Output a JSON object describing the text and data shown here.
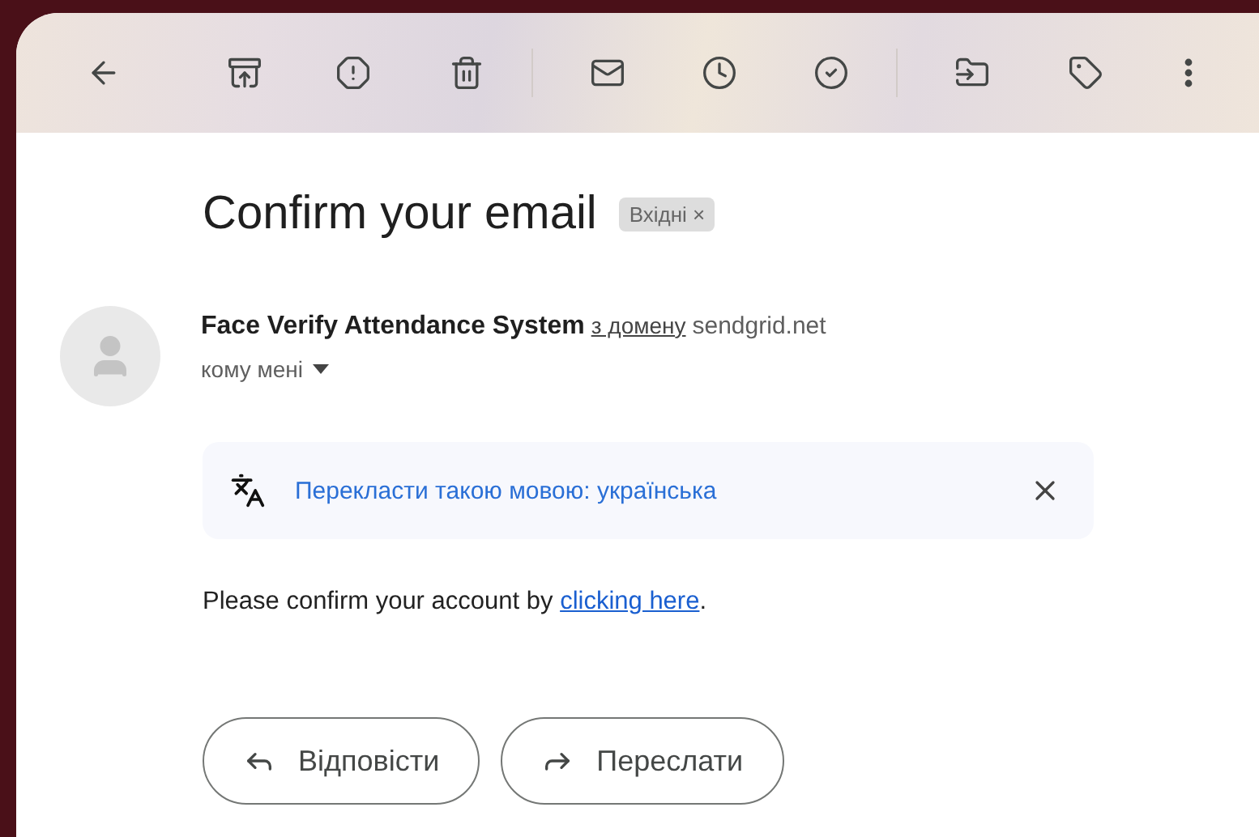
{
  "subject": "Confirm your email",
  "label": {
    "text": "Вхідні",
    "remove": "×"
  },
  "sender": {
    "name": "Face Verify Attendance System",
    "via": "з домену",
    "domain": "sendgrid.net",
    "recipients": "кому мені"
  },
  "translate_bar": {
    "text": "Перекласти такою мовою: українська"
  },
  "body": {
    "before": "Please confirm your account by ",
    "link": "clicking here",
    "after": "."
  },
  "actions": [
    {
      "kind": "reply",
      "label": "Відповісти"
    },
    {
      "kind": "forward",
      "label": "Переслати"
    }
  ]
}
